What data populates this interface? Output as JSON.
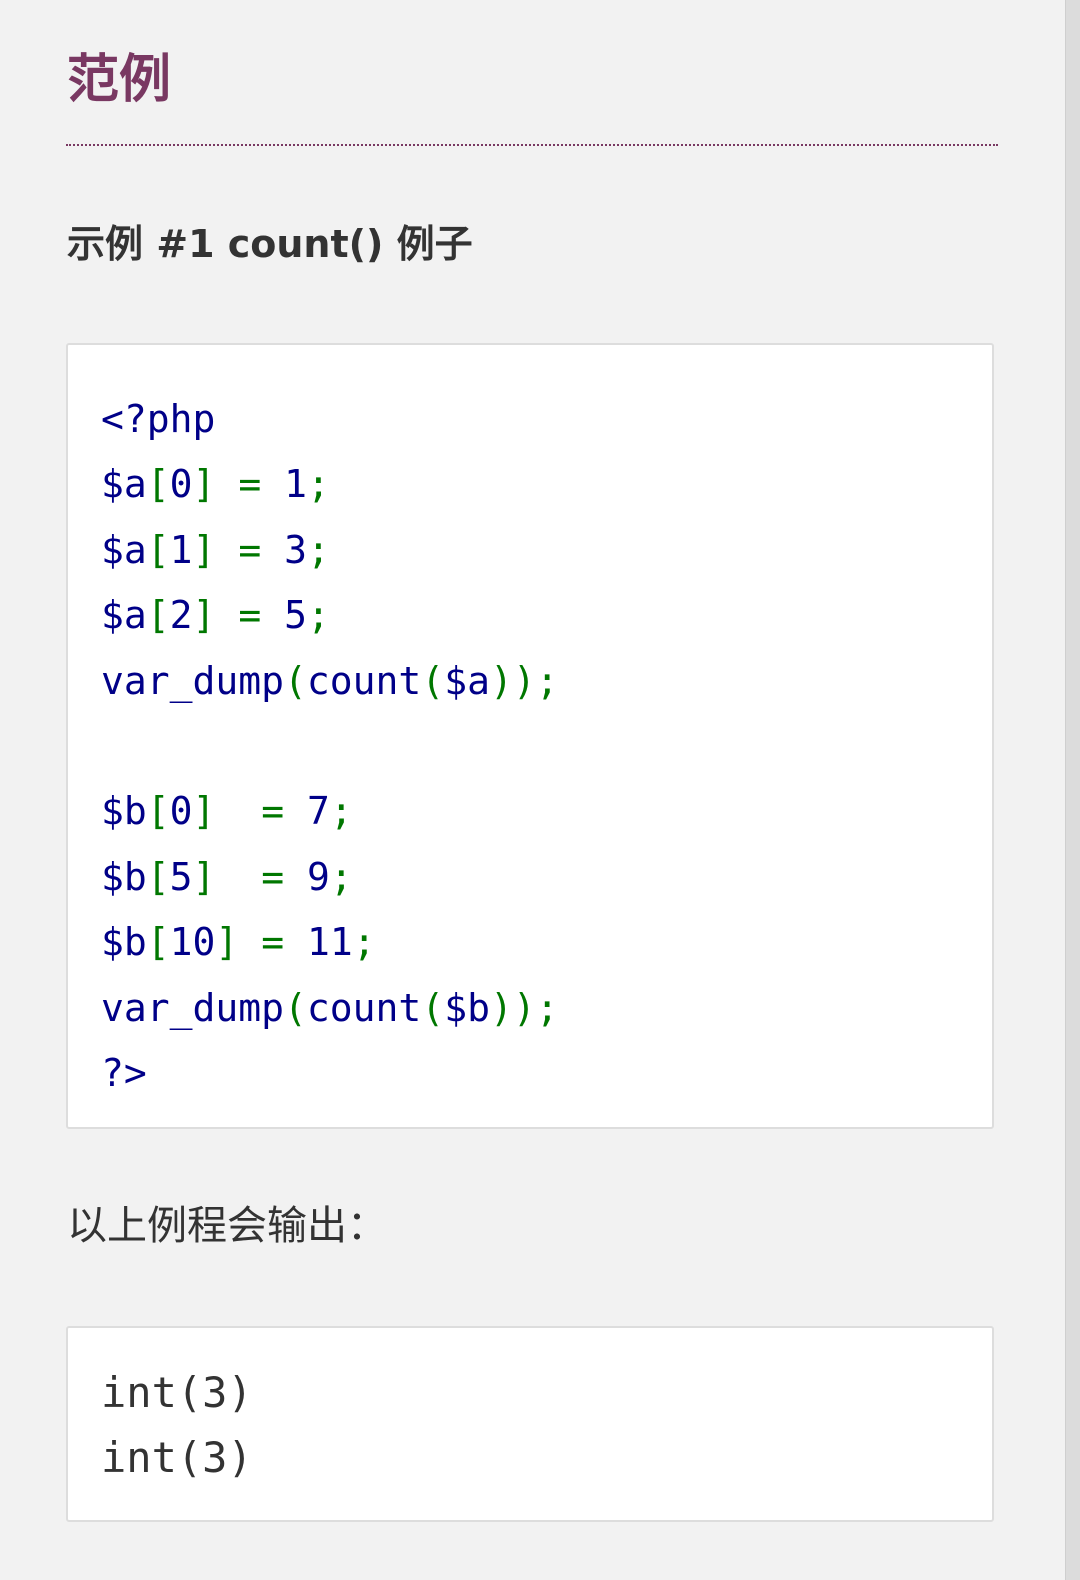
{
  "section": {
    "title": "范例"
  },
  "example": {
    "title": "示例 #1 count() 例子",
    "code_lines": [
      [
        {
          "t": "<?php",
          "c": "kw"
        }
      ],
      [
        {
          "t": "$a",
          "c": "var"
        },
        {
          "t": "[",
          "c": "punc"
        },
        {
          "t": "0",
          "c": "num"
        },
        {
          "t": "]",
          "c": "punc"
        },
        {
          "t": " ",
          "c": "var"
        },
        {
          "t": "=",
          "c": "punc"
        },
        {
          "t": " 1",
          "c": "num"
        },
        {
          "t": ";",
          "c": "punc"
        }
      ],
      [
        {
          "t": "$a",
          "c": "var"
        },
        {
          "t": "[",
          "c": "punc"
        },
        {
          "t": "1",
          "c": "num"
        },
        {
          "t": "]",
          "c": "punc"
        },
        {
          "t": " ",
          "c": "var"
        },
        {
          "t": "=",
          "c": "punc"
        },
        {
          "t": " 3",
          "c": "num"
        },
        {
          "t": ";",
          "c": "punc"
        }
      ],
      [
        {
          "t": "$a",
          "c": "var"
        },
        {
          "t": "[",
          "c": "punc"
        },
        {
          "t": "2",
          "c": "num"
        },
        {
          "t": "]",
          "c": "punc"
        },
        {
          "t": " ",
          "c": "var"
        },
        {
          "t": "=",
          "c": "punc"
        },
        {
          "t": " 5",
          "c": "num"
        },
        {
          "t": ";",
          "c": "punc"
        }
      ],
      [
        {
          "t": "var_dump",
          "c": "fn"
        },
        {
          "t": "(",
          "c": "punc"
        },
        {
          "t": "count",
          "c": "fn"
        },
        {
          "t": "(",
          "c": "punc"
        },
        {
          "t": "$a",
          "c": "var"
        },
        {
          "t": "));",
          "c": "punc"
        }
      ],
      [
        {
          "t": "",
          "c": "var"
        }
      ],
      [
        {
          "t": "$b",
          "c": "var"
        },
        {
          "t": "[",
          "c": "punc"
        },
        {
          "t": "0",
          "c": "num"
        },
        {
          "t": "]",
          "c": "punc"
        },
        {
          "t": "  ",
          "c": "var"
        },
        {
          "t": "=",
          "c": "punc"
        },
        {
          "t": " 7",
          "c": "num"
        },
        {
          "t": ";",
          "c": "punc"
        }
      ],
      [
        {
          "t": "$b",
          "c": "var"
        },
        {
          "t": "[",
          "c": "punc"
        },
        {
          "t": "5",
          "c": "num"
        },
        {
          "t": "]",
          "c": "punc"
        },
        {
          "t": "  ",
          "c": "var"
        },
        {
          "t": "=",
          "c": "punc"
        },
        {
          "t": " 9",
          "c": "num"
        },
        {
          "t": ";",
          "c": "punc"
        }
      ],
      [
        {
          "t": "$b",
          "c": "var"
        },
        {
          "t": "[",
          "c": "punc"
        },
        {
          "t": "10",
          "c": "num"
        },
        {
          "t": "]",
          "c": "punc"
        },
        {
          "t": " ",
          "c": "var"
        },
        {
          "t": "=",
          "c": "punc"
        },
        {
          "t": " 11",
          "c": "num"
        },
        {
          "t": ";",
          "c": "punc"
        }
      ],
      [
        {
          "t": "var_dump",
          "c": "fn"
        },
        {
          "t": "(",
          "c": "punc"
        },
        {
          "t": "count",
          "c": "fn"
        },
        {
          "t": "(",
          "c": "punc"
        },
        {
          "t": "$b",
          "c": "var"
        },
        {
          "t": "));",
          "c": "punc"
        }
      ],
      [
        {
          "t": "?>",
          "c": "kw"
        }
      ]
    ],
    "output_caption": "以上例程会输出：",
    "output_lines": [
      "int(3)",
      "int(3)"
    ]
  },
  "colors": {
    "heading": "#793862",
    "code_default": "#000088",
    "code_punctuation": "#007700",
    "text": "#333333",
    "background": "#f2f2f2"
  }
}
